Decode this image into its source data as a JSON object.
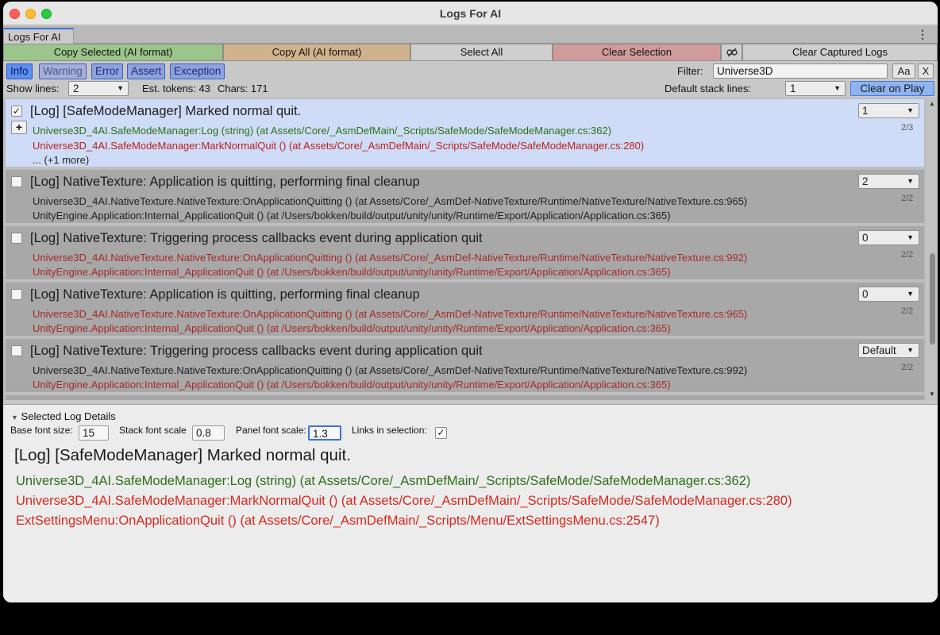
{
  "window": {
    "title": "Logs For AI",
    "tab": "Logs For AI"
  },
  "actions": {
    "copy_selected": "Copy Selected (AI format)",
    "copy_all": "Copy All (AI format)",
    "select_all": "Select All",
    "clear_selection": "Clear Selection",
    "clear_captured": "Clear Captured Logs"
  },
  "filters": {
    "types": [
      "Info",
      "Warning",
      "Error",
      "Assert",
      "Exception"
    ],
    "filter_label": "Filter:",
    "filter_value": "Universe3D",
    "match_case": "Aa",
    "clear": "X"
  },
  "options": {
    "show_lines_label": "Show lines:",
    "show_lines_value": "2",
    "tokens": "Est. tokens: 43",
    "chars": "Chars: 171",
    "default_stack_label": "Default stack lines:",
    "default_stack_value": "1",
    "clear_on_play": "Clear on Play"
  },
  "logs": [
    {
      "title": "[Log] [SafeModeManager] Marked normal quit.",
      "checked": "✓",
      "dropdown": "1",
      "count": "2/3",
      "stack": [
        "Universe3D_4AI.SafeModeManager:Log (string) (at Assets/Core/_AsmDefMain/_Scripts/SafeMode/SafeModeManager.cs:362)",
        "Universe3D_4AI.SafeModeManager:MarkNormalQuit () (at Assets/Core/_AsmDefMain/_Scripts/SafeMode/SafeModeManager.cs:280)"
      ],
      "more": "... (+1 more)"
    },
    {
      "title": "[Log] NativeTexture: Application is quitting, performing final cleanup",
      "dropdown": "2",
      "count": "2/2",
      "stack": [
        "Universe3D_4AI.NativeTexture.NativeTexture:OnApplicationQuitting () (at Assets/Core/_AsmDef-NativeTexture/Runtime/NativeTexture/NativeTexture.cs:965)",
        "UnityEngine.Application:Internal_ApplicationQuit () (at /Users/bokken/build/output/unity/unity/Runtime/Export/Application/Application.cs:365)"
      ]
    },
    {
      "title": "[Log] NativeTexture: Triggering process callbacks event during application quit",
      "dropdown": "0",
      "count": "2/2",
      "stack": [
        "Universe3D_4AI.NativeTexture.NativeTexture:OnApplicationQuitting () (at Assets/Core/_AsmDef-NativeTexture/Runtime/NativeTexture/NativeTexture.cs:992)",
        "UnityEngine.Application:Internal_ApplicationQuit () (at /Users/bokken/build/output/unity/unity/Runtime/Export/Application/Application.cs:365)"
      ]
    },
    {
      "title": "[Log] NativeTexture: Application is quitting, performing final cleanup",
      "dropdown": "0",
      "count": "2/2",
      "stack": [
        "Universe3D_4AI.NativeTexture.NativeTexture:OnApplicationQuitting () (at Assets/Core/_AsmDef-NativeTexture/Runtime/NativeTexture/NativeTexture.cs:965)",
        "UnityEngine.Application:Internal_ApplicationQuit () (at /Users/bokken/build/output/unity/unity/Runtime/Export/Application/Application.cs:365)"
      ]
    },
    {
      "title": "[Log] NativeTexture: Triggering process callbacks event during application quit",
      "dropdown": "Default",
      "count": "2/2",
      "stack": [
        "Universe3D_4AI.NativeTexture.NativeTexture:OnApplicationQuitting () (at Assets/Core/_AsmDef-NativeTexture/Runtime/NativeTexture/NativeTexture.cs:992)",
        "UnityEngine.Application:Internal_ApplicationQuit () (at /Users/bokken/build/output/unity/unity/Runtime/Export/Application/Application.cs:365)"
      ]
    }
  ],
  "details": {
    "header": "Selected Log Details",
    "base_font_label": "Base font size:",
    "base_font_value": "15",
    "stack_scale_label": "Stack font scale",
    "stack_scale_value": "0.8",
    "panel_scale_label": "Panel font scale:",
    "panel_scale_value": "1.3",
    "links_label": "Links in selection:",
    "links_checked": "✓",
    "title": "[Log] [SafeModeManager] Marked normal quit.",
    "lines": [
      "Universe3D_4AI.SafeModeManager:Log (string) (at Assets/Core/_AsmDefMain/_Scripts/SafeMode/SafeModeManager.cs:362)",
      "Universe3D_4AI.SafeModeManager:MarkNormalQuit () (at Assets/Core/_AsmDefMain/_Scripts/SafeMode/SafeModeManager.cs:280)",
      "ExtSettingsMenu:OnApplicationQuit () (at Assets/Core/_AsmDefMain/_Scripts/Menu/ExtSettingsMenu.cs:2547)"
    ]
  },
  "colors": {
    "copy_selected_bg": "#9cc58c",
    "copy_all_bg": "#d0b28d",
    "clear_selection_bg": "#d29b9b",
    "selected_row_bg": "#cfdcf7",
    "stack_green": "#2a6f17",
    "stack_red": "#bb1e1e"
  }
}
